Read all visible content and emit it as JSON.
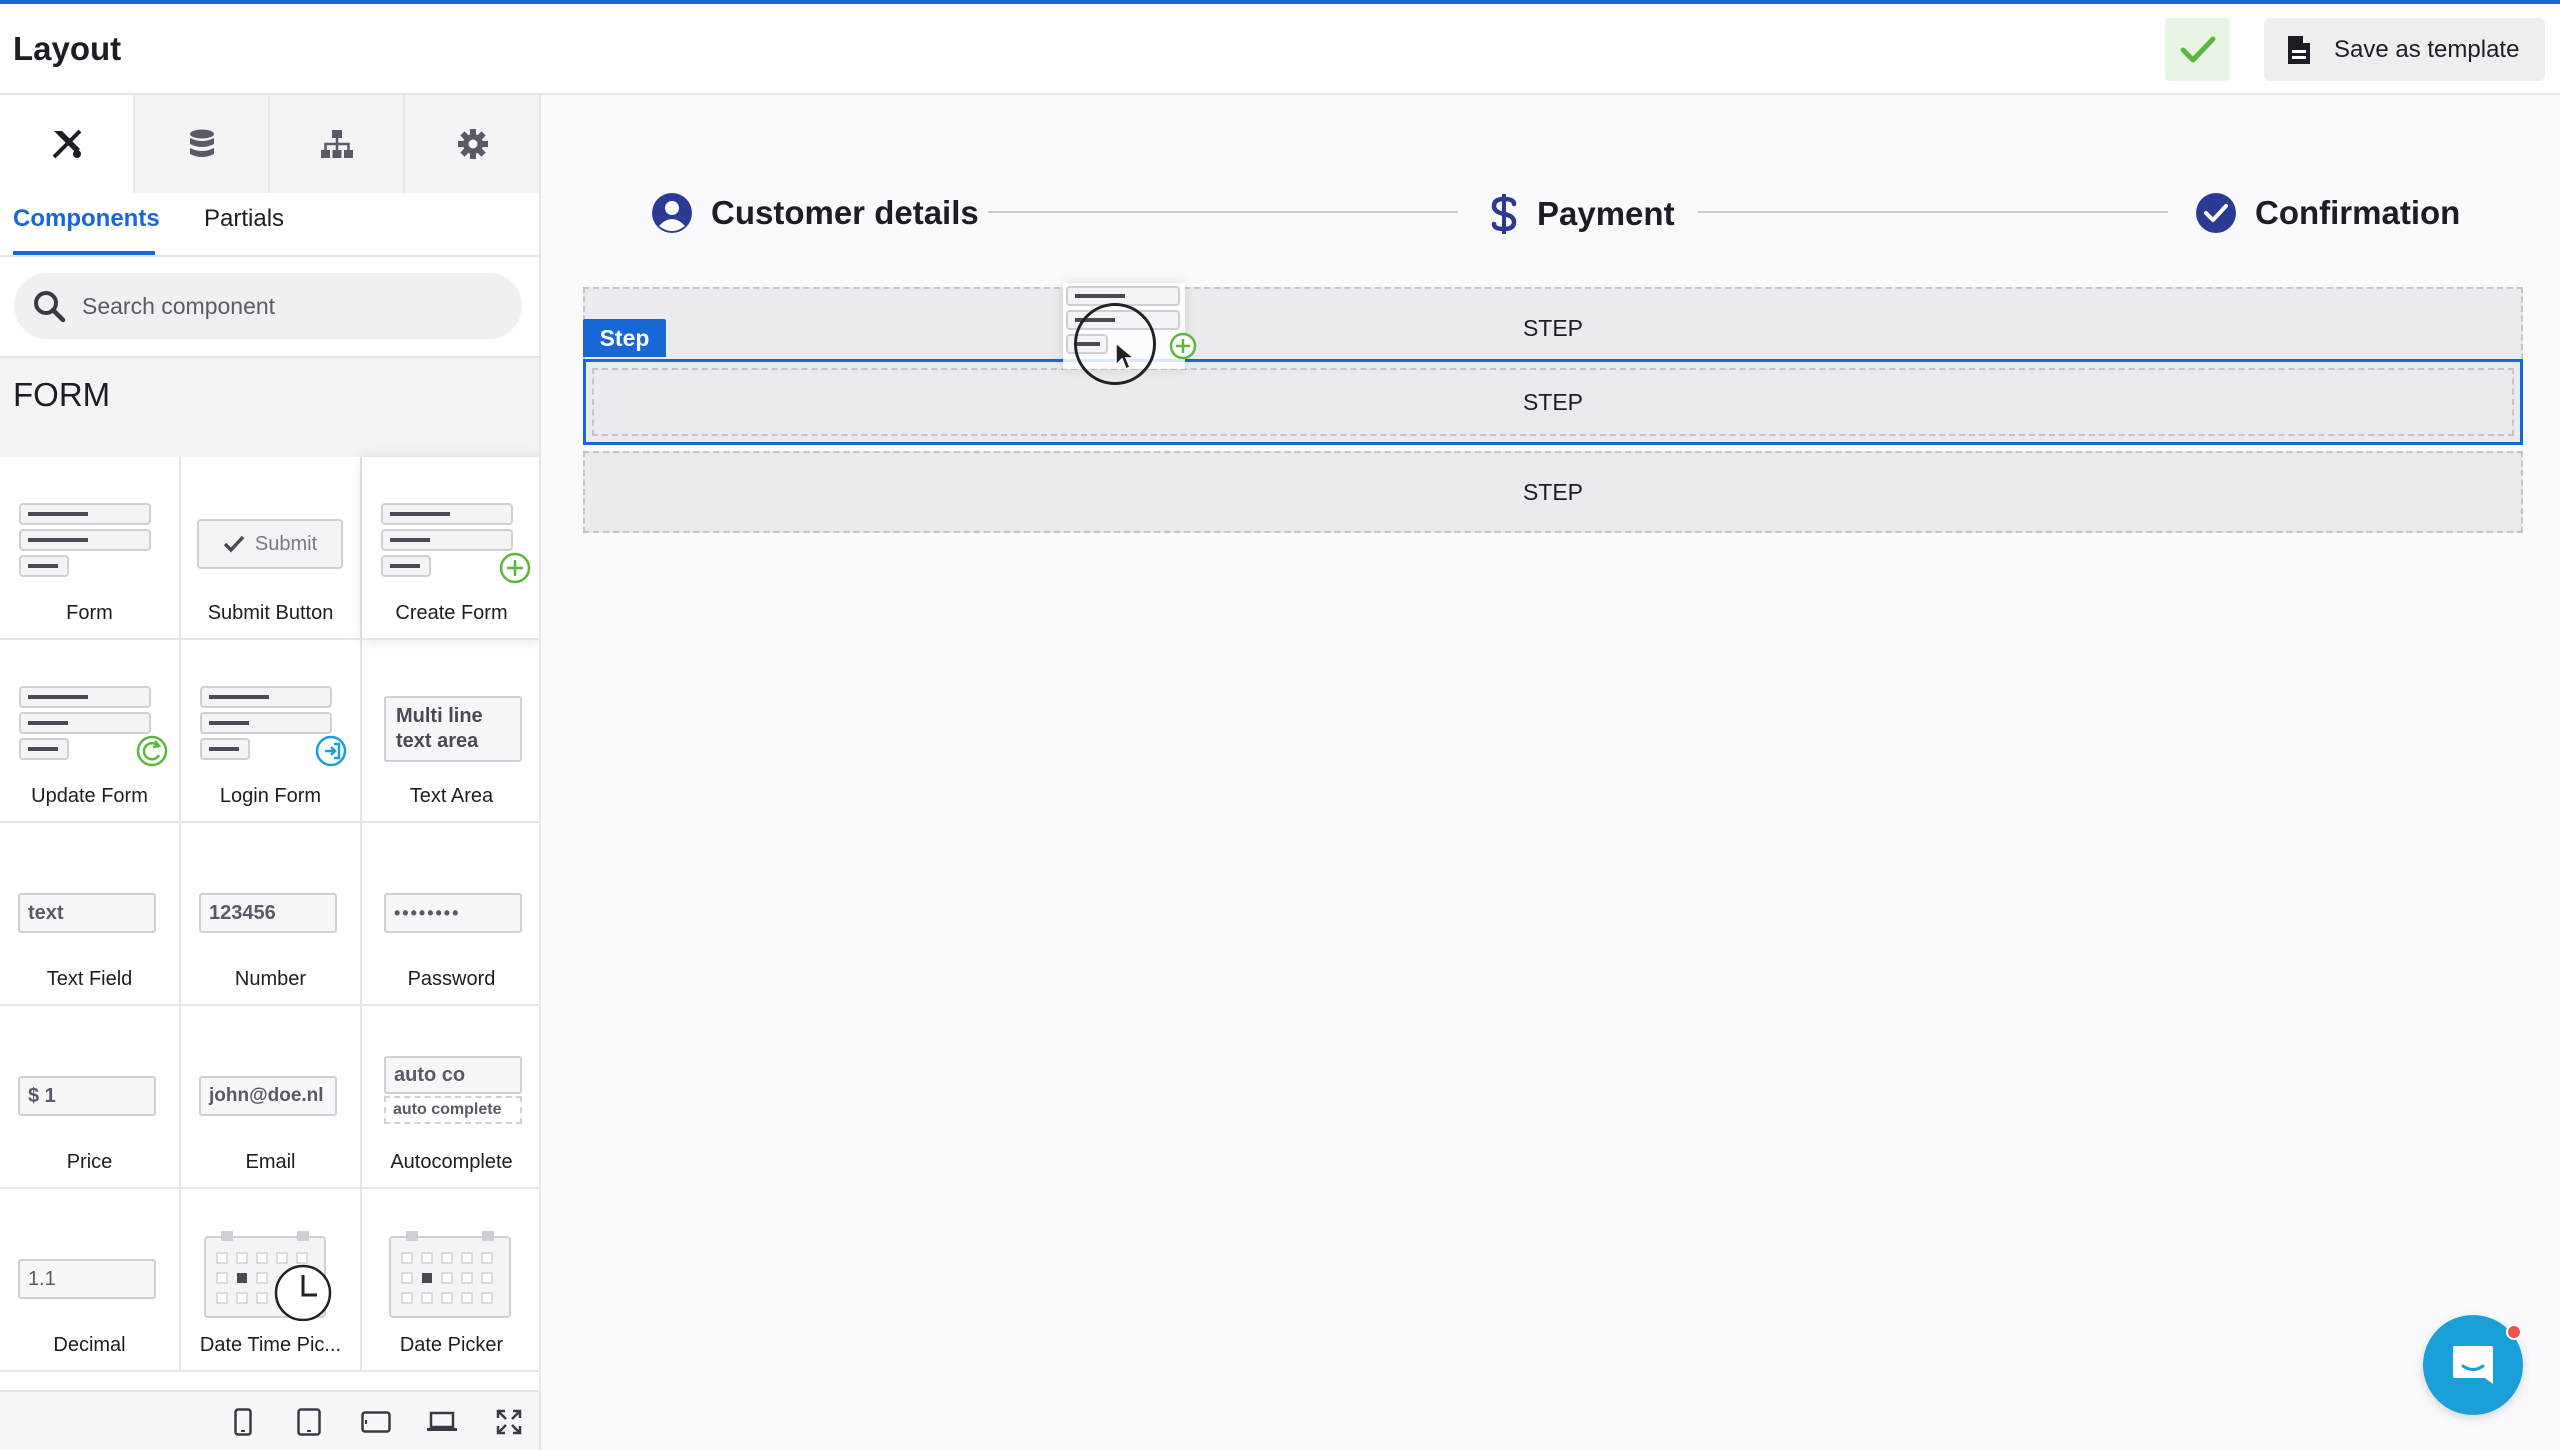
{
  "header": {
    "title": "Layout",
    "save_label": "Save as template"
  },
  "sidebar": {
    "tabs": [
      {
        "icon": "tools-icon",
        "active": true
      },
      {
        "icon": "database-icon",
        "active": false
      },
      {
        "icon": "sitemap-icon",
        "active": false
      },
      {
        "icon": "gear-icon",
        "active": false
      }
    ],
    "subtabs": {
      "components": "Components",
      "partials": "Partials"
    },
    "search": {
      "placeholder": "Search component"
    },
    "section_title": "FORM",
    "components": [
      {
        "label": "Form"
      },
      {
        "label": "Submit Button",
        "text": "Submit"
      },
      {
        "label": "Create Form"
      },
      {
        "label": "Update Form"
      },
      {
        "label": "Login Form"
      },
      {
        "label": "Text Area",
        "text": "Multi line text area"
      },
      {
        "label": "Text Field",
        "text": "text"
      },
      {
        "label": "Number",
        "text": "123456"
      },
      {
        "label": "Password",
        "text": "••••••••"
      },
      {
        "label": "Price",
        "text": "$ 1"
      },
      {
        "label": "Email",
        "text": "john@doe.nl"
      },
      {
        "label": "Autocomplete",
        "text": "auto co",
        "subtext": "auto complete"
      },
      {
        "label": "Decimal",
        "text": "1.1"
      },
      {
        "label": "Date Time Pic..."
      },
      {
        "label": "Date Picker"
      }
    ],
    "devices": [
      "mobile-icon",
      "tablet-icon",
      "tablet-landscape-icon",
      "laptop-icon",
      "fullscreen-icon"
    ]
  },
  "main": {
    "stepper": [
      {
        "label": "Customer details",
        "icon": "user-circle-icon"
      },
      {
        "label": "Payment",
        "icon": "dollar-icon"
      },
      {
        "label": "Confirmation",
        "icon": "check-circle-icon"
      }
    ],
    "step_badge": "Step",
    "rows": [
      "STEP",
      "STEP",
      "STEP"
    ]
  },
  "colors": {
    "accent": "#1867d6",
    "stepper_icon": "#2b3a93",
    "success": "#5cb83c",
    "chat": "#1a9fd9"
  }
}
